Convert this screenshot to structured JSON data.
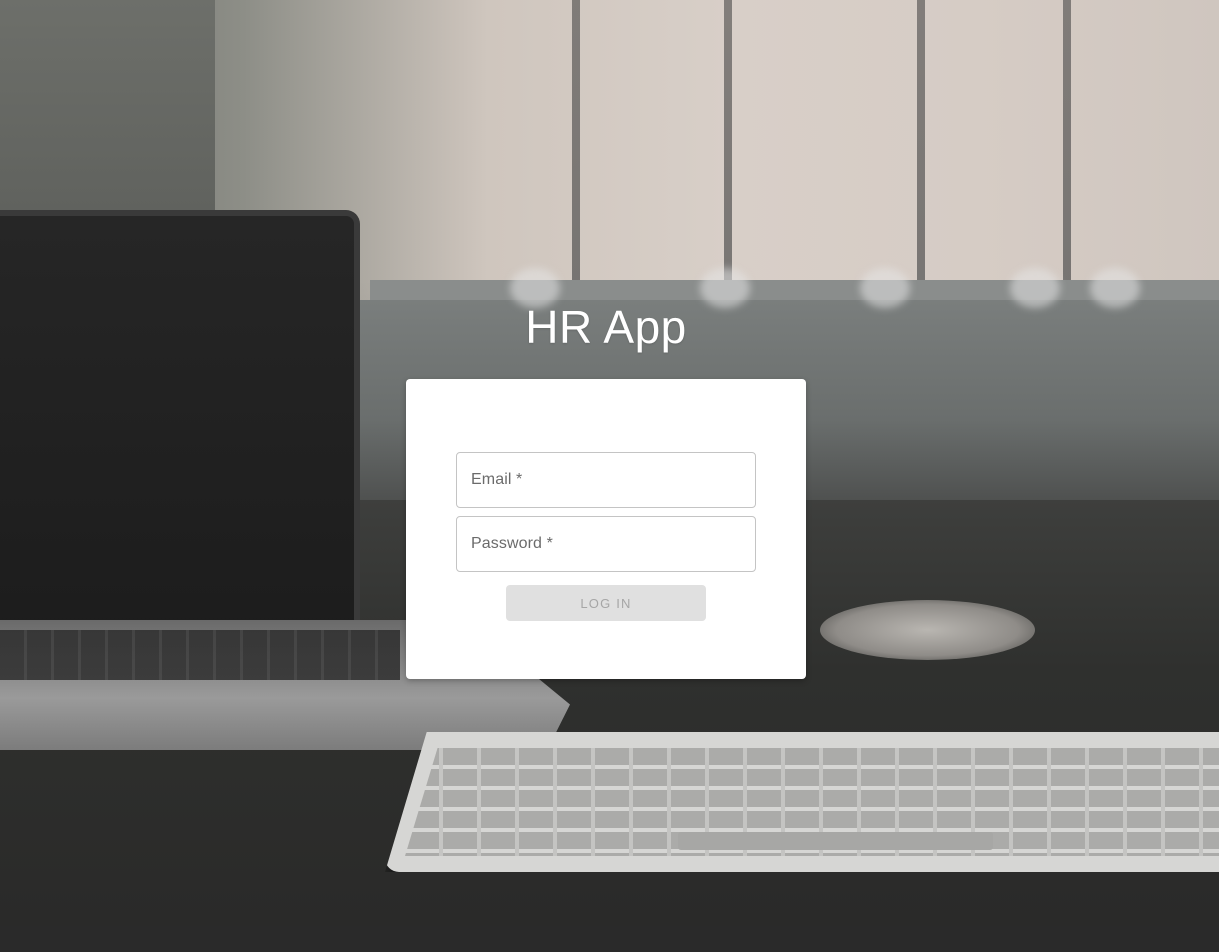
{
  "app": {
    "title": "HR App"
  },
  "login_form": {
    "email": {
      "label": "Email *",
      "value": ""
    },
    "password": {
      "label": "Password *",
      "value": ""
    },
    "submit_label": "LOG IN",
    "submit_disabled": true
  },
  "colors": {
    "card_background": "#ffffff",
    "title_text": "#ffffff",
    "button_disabled_background": "#e0e0e0",
    "button_disabled_text": "#a6a6a6",
    "field_border": "#c4c4c4",
    "field_label": "#6b6b6b"
  }
}
